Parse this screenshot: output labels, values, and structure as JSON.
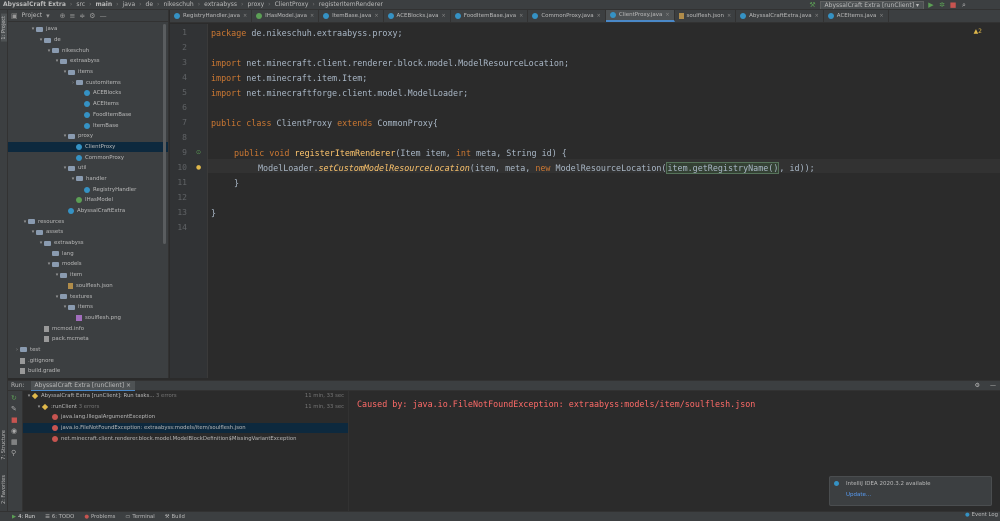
{
  "breadcrumb": {
    "items": [
      "AbyssalCraft Extra",
      "src",
      "main",
      "java",
      "de",
      "nikeschuh",
      "extraabyss",
      "proxy",
      "ClientProxy",
      "registerItemRenderer"
    ]
  },
  "run_config": {
    "label": "AbyssalCraft Extra [runClient]"
  },
  "left_strip": {
    "project": "1: Project",
    "structure": "7: Structure",
    "favorites": "2: Favorites"
  },
  "project_panel": {
    "title": "Project"
  },
  "tree": [
    {
      "label": "java",
      "icon": "folder",
      "open": true
    },
    {
      "label": "de",
      "icon": "pkg",
      "open": true
    },
    {
      "label": "nikeschuh",
      "icon": "pkg",
      "open": true
    },
    {
      "label": "extraabyss",
      "icon": "pkg",
      "open": true
    },
    {
      "label": "items",
      "icon": "pkg",
      "open": true
    },
    {
      "label": "customitems",
      "icon": "pkg",
      "open": false
    },
    {
      "label": "ACEBlocks",
      "icon": "java"
    },
    {
      "label": "ACEItems",
      "icon": "java"
    },
    {
      "label": "FoodItemBase",
      "icon": "java"
    },
    {
      "label": "ItemBase",
      "icon": "java"
    },
    {
      "label": "proxy",
      "icon": "pkg",
      "open": true
    },
    {
      "label": "ClientProxy",
      "icon": "java",
      "selected": true
    },
    {
      "label": "CommonProxy",
      "icon": "java"
    },
    {
      "label": "util",
      "icon": "pkg",
      "open": true
    },
    {
      "label": "handler",
      "icon": "pkg",
      "open": true
    },
    {
      "label": "RegistryHandler",
      "icon": "java"
    },
    {
      "label": "IHasModel",
      "icon": "interface"
    },
    {
      "label": "AbyssalCraftExtra",
      "icon": "java"
    },
    {
      "label": "resources",
      "icon": "folder",
      "open": true
    },
    {
      "label": "assets",
      "icon": "folder",
      "open": true
    },
    {
      "label": "extraabyss",
      "icon": "folder",
      "open": true
    },
    {
      "label": "lang",
      "icon": "folder"
    },
    {
      "label": "models",
      "icon": "folder",
      "open": true
    },
    {
      "label": "item",
      "icon": "folder",
      "open": true
    },
    {
      "label": "soulflesh.json",
      "icon": "json"
    },
    {
      "label": "textures",
      "icon": "folder",
      "open": true
    },
    {
      "label": "items",
      "icon": "folder",
      "open": true
    },
    {
      "label": "soulflesh.png",
      "icon": "png"
    },
    {
      "label": "mcmod.info",
      "icon": "txt"
    },
    {
      "label": "pack.mcmeta",
      "icon": "txt"
    },
    {
      "label": "test",
      "icon": "folder",
      "open": false
    },
    {
      "label": ".gitignore",
      "icon": "txt"
    },
    {
      "label": "build.gradle",
      "icon": "txt"
    }
  ],
  "tabs": [
    {
      "label": "RegistryHandler.java"
    },
    {
      "label": "IHasModel.java"
    },
    {
      "label": "ItemBase.java"
    },
    {
      "label": "ACEBlocks.java"
    },
    {
      "label": "FoodItemBase.java"
    },
    {
      "label": "CommonProxy.java"
    },
    {
      "label": "ClientProxy.java",
      "active": true
    },
    {
      "label": "soulflesh.json"
    },
    {
      "label": "AbyssalCraftExtra.java"
    },
    {
      "label": "ACEItems.java"
    }
  ],
  "editor": {
    "warning_count": "▲2",
    "line_numbers": [
      "1",
      "2",
      "3",
      "4",
      "5",
      "6",
      "7",
      "8",
      "9",
      "10",
      "11",
      "12",
      "13",
      "14"
    ],
    "code": {
      "l1_kw": "package",
      "l1_rest": " de.nikeschuh.extraabyss.proxy;",
      "l3_kw": "import",
      "l3_rest": " net.minecraft.client.renderer.block.model.ModelResourceLocation;",
      "l4_kw": "import",
      "l4_rest": " net.minecraft.item.Item;",
      "l5_kw": "import",
      "l5_rest": " net.minecraftforge.client.model.ModelLoader;",
      "l7_kw1": "public class",
      "l7_cls": " ClientProxy ",
      "l7_kw2": "extends",
      "l7_rest": " CommonProxy{",
      "l9_kw": "public void",
      "l9_mth": "registerItemRenderer",
      "l9_p1": "(Item item, ",
      "l9_kw2": "int",
      "l9_p2": " meta, String id) {",
      "l10_a": "ModelLoader.",
      "l10_mth": "setCustomModelResourceLocation",
      "l10_b": "(item, meta, ",
      "l10_kw": "new",
      "l10_c": " ModelResourceLocation(",
      "l10_hl": "item.getRegistryName()",
      "l10_d": ", id));",
      "l11": "}",
      "l13": "}"
    }
  },
  "bottom": {
    "run_label": "Run:",
    "run_tab": "AbyssalCraft Extra [runClient]",
    "rows": [
      {
        "label": "AbyssalCraft Extra [runClient]: Run tasks...",
        "extra": "3 errors",
        "time": "11 min, 33 sec"
      },
      {
        "label": ":runClient",
        "extra": "3 errors",
        "time": "11 min, 33 sec"
      },
      {
        "label": "java.lang.IllegalArgumentException"
      },
      {
        "label": "java.io.FileNotFoundException: extraabyss:models/item/soulflesh.json",
        "selected": true
      },
      {
        "label": "net.minecraft.client.renderer.block.model.ModelBlockDefinition$MissingVariantException"
      }
    ],
    "console": "Caused by: java.io.FileNotFoundException: extraabyss:models/item/soulflesh.json"
  },
  "notification": {
    "title": "IntelliJ IDEA 2020.3.2 available",
    "action": "Update..."
  },
  "status": {
    "run": "4: Run",
    "todo": "6: TODO",
    "problems": "Problems",
    "terminal": "Terminal",
    "build": "Build",
    "event_log": "Event Log"
  }
}
